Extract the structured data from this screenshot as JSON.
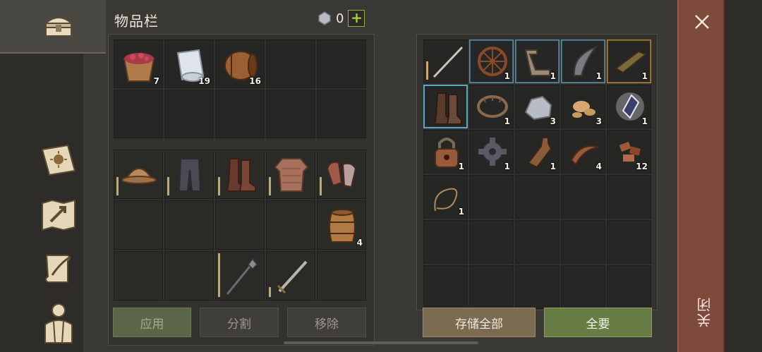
{
  "header": {
    "title": "物品栏",
    "currency_value": "0",
    "add_label": "+"
  },
  "buttons": {
    "apply": "应用",
    "split": "分割",
    "remove": "移除",
    "store_all": "存储全部",
    "take_all": "全要",
    "close": "关闭"
  },
  "inventory": {
    "items": [
      {
        "name": "berry-basket",
        "count": "7"
      },
      {
        "name": "cloth-roll",
        "count": "19"
      },
      {
        "name": "wooden-barrel",
        "count": "16"
      }
    ]
  },
  "equipment": {
    "armor": [
      "helmet",
      "leather-pants",
      "boots",
      "chainmail-shirt",
      "chainmail-gloves"
    ],
    "backpack_item": {
      "name": "storage-barrel",
      "count": "4"
    },
    "weapons": [
      "spiked-mace",
      "long-sword"
    ]
  },
  "storage": {
    "items": [
      {
        "name": "sword",
        "count": ""
      },
      {
        "name": "wagon-wheel",
        "count": "1"
      },
      {
        "name": "crank-part",
        "count": "1"
      },
      {
        "name": "curved-blade",
        "count": "1"
      },
      {
        "name": "framed-plate",
        "count": "1"
      },
      {
        "name": "boots",
        "count": ""
      },
      {
        "name": "bear-trap",
        "count": "1"
      },
      {
        "name": "iron-ore",
        "count": "3"
      },
      {
        "name": "seeds",
        "count": "3"
      },
      {
        "name": "crystal",
        "count": "1"
      },
      {
        "name": "padlock",
        "count": "1"
      },
      {
        "name": "gear-part",
        "count": "1"
      },
      {
        "name": "flask",
        "count": "1"
      },
      {
        "name": "leather-strips",
        "count": "4"
      },
      {
        "name": "scrap-pieces",
        "count": "12"
      },
      {
        "name": "rope",
        "count": "1"
      }
    ]
  }
}
